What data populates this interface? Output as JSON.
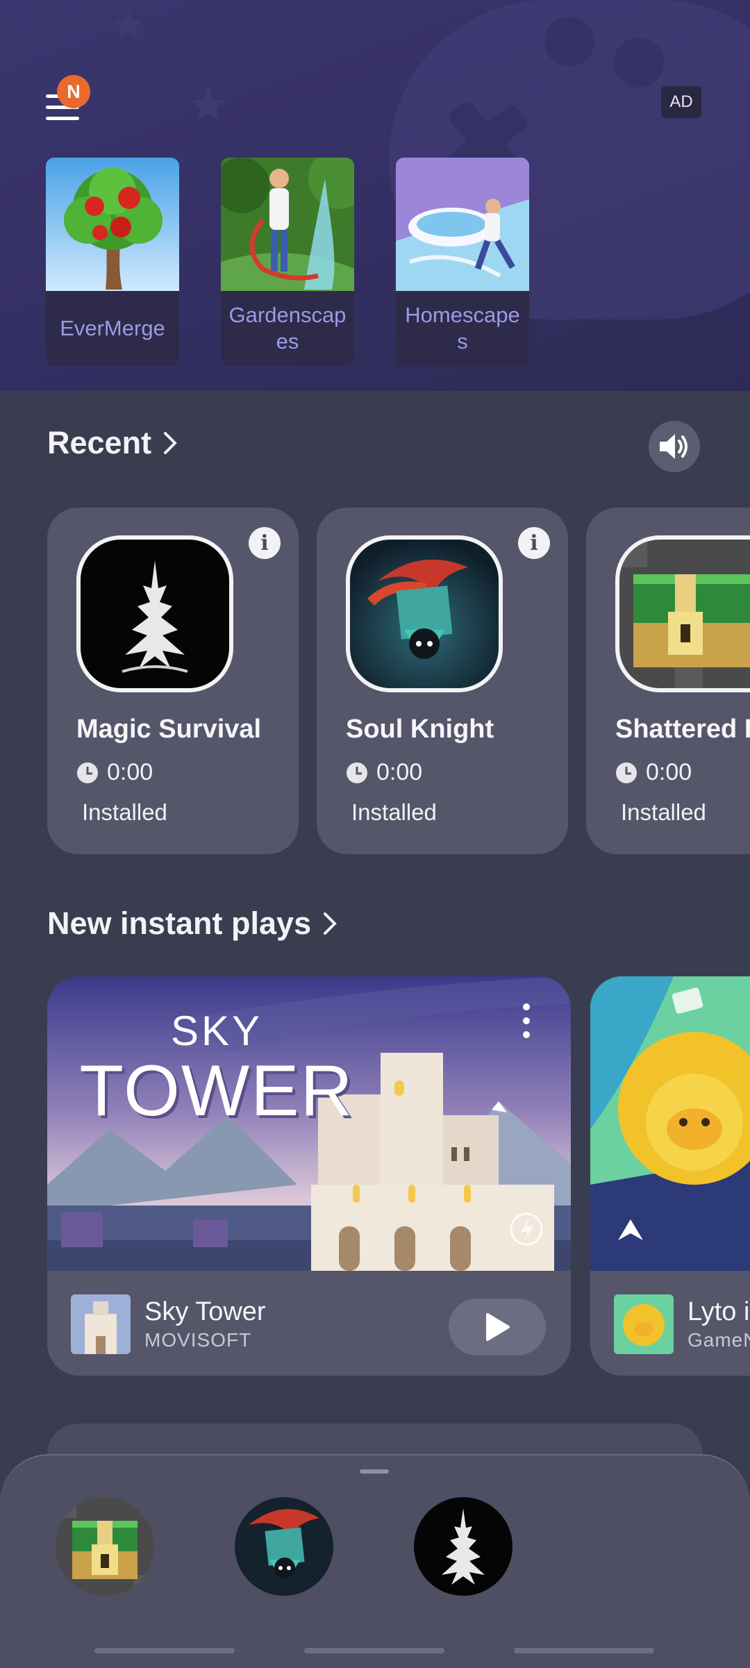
{
  "header": {
    "notification_badge": "N",
    "ad_label": "AD",
    "ads": [
      {
        "name": "EverMerge",
        "icon": "apple-tree-icon"
      },
      {
        "name": "Gardenscapes",
        "icon": "garden-hose-icon"
      },
      {
        "name": "Homescapes",
        "icon": "bathtub-icon"
      }
    ]
  },
  "recent": {
    "title": "Recent",
    "games": [
      {
        "title": "Magic Survival",
        "time": "0:00",
        "status": "Installed"
      },
      {
        "title": "Soul Knight",
        "time": "0:00",
        "status": "Installed"
      },
      {
        "title": "Shattered P",
        "time": "0:00",
        "status": "Installed"
      }
    ]
  },
  "instant": {
    "title": "New instant plays",
    "games": [
      {
        "banner_line1": "SKY",
        "banner_line2": "TOWER",
        "title": "Sky Tower",
        "developer": "MOVISOFT"
      },
      {
        "title": "Lyto i",
        "developer": "GameN"
      }
    ]
  },
  "dock": {
    "icons": [
      "treasure-chest-icon",
      "soul-knight-icon",
      "magic-survival-icon"
    ]
  },
  "colors": {
    "header_bg": "#342f63",
    "page_bg": "#3a3c4f",
    "card_bg": "#55566a",
    "ad_name": "#9d98e6",
    "badge": "#e96a2c"
  }
}
